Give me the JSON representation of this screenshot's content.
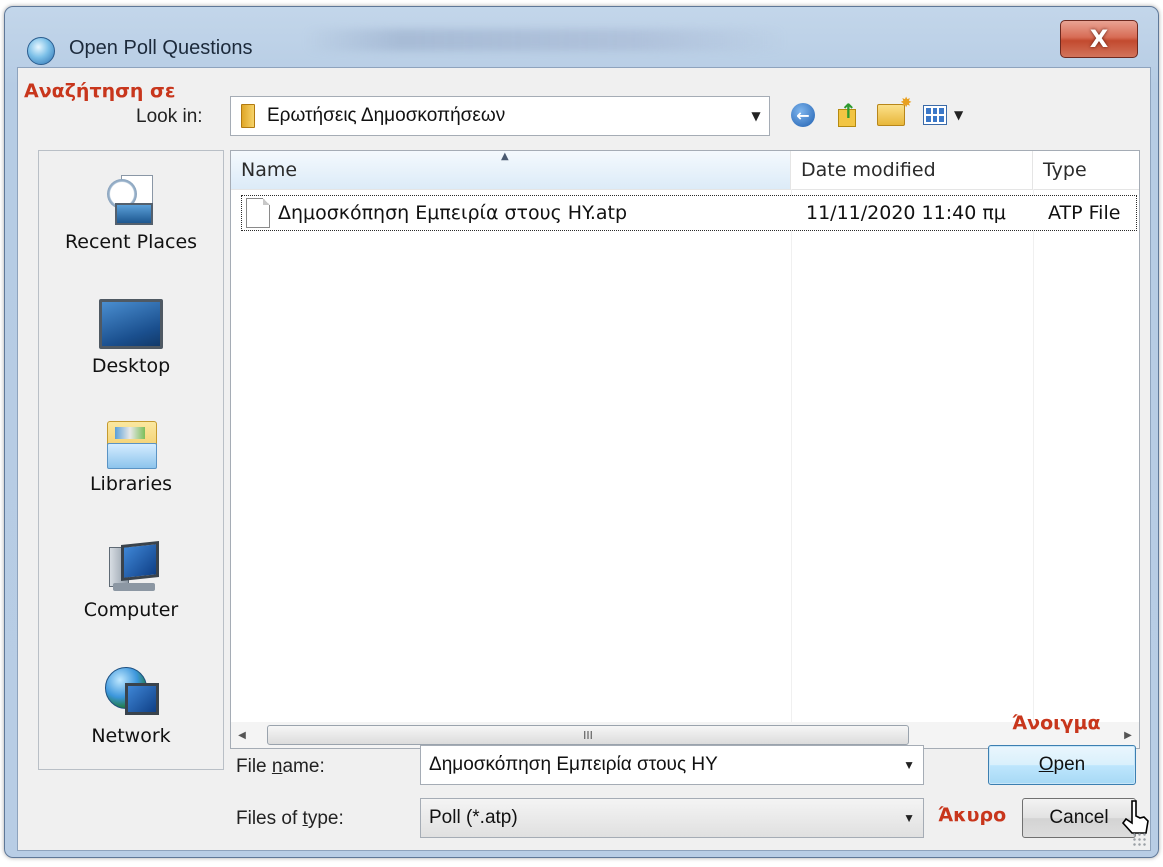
{
  "window": {
    "title": "Open Poll Questions",
    "close_glyph": "X"
  },
  "annotations": {
    "look_in_gr": "Αναζήτηση σε",
    "open_gr": "Άνοιγμα",
    "cancel_gr": "Άκυρο",
    "color": "#c8361c"
  },
  "lookin": {
    "label": "Look in:",
    "value": "Ερωτήσεις Δημοσκοπήσεων"
  },
  "toolbar": {
    "icons": [
      "back-icon",
      "up-folder-icon",
      "new-folder-icon",
      "view-menu-icon"
    ]
  },
  "places": [
    {
      "label": "Recent Places",
      "icon": "recent-places-icon"
    },
    {
      "label": "Desktop",
      "icon": "desktop-icon"
    },
    {
      "label": "Libraries",
      "icon": "libraries-icon"
    },
    {
      "label": "Computer",
      "icon": "computer-icon"
    },
    {
      "label": "Network",
      "icon": "network-icon"
    }
  ],
  "filelist": {
    "columns": [
      "Name",
      "Date modified",
      "Type"
    ],
    "rows": [
      {
        "name": "Δημοσκόπηση Εμπειρία στους HY.atp",
        "date": "11/11/2020 11:40 πμ",
        "type": "ATP File"
      }
    ],
    "scroll_thumb_glyph": "III"
  },
  "form": {
    "filename_label_pre": "File ",
    "filename_label_u": "n",
    "filename_label_post": "ame:",
    "filename_value": "Δημοσκόπηση Εμπειρία στους HY",
    "filetype_label_pre": "Files of ",
    "filetype_label_u": "t",
    "filetype_label_post": "ype:",
    "filetype_value": "Poll (*.atp)"
  },
  "buttons": {
    "open_u": "O",
    "open_rest": "pen",
    "cancel": "Cancel"
  },
  "colors": {
    "accent_red": "#c8361c",
    "close_button": "#c24a2f",
    "default_button_border": "#3c7fb1"
  }
}
